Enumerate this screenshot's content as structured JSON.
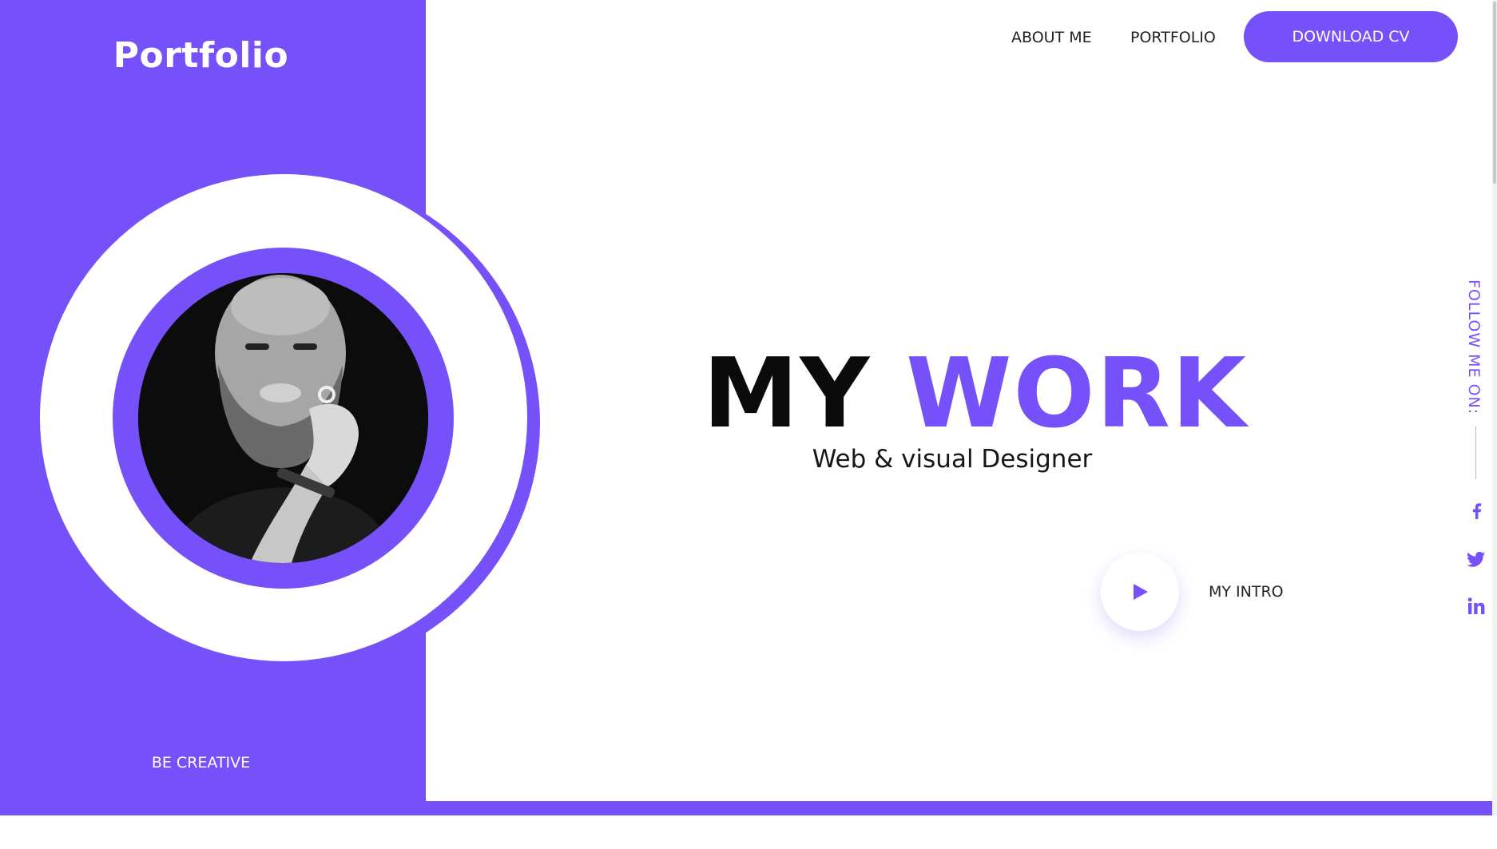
{
  "brand": {
    "title": "Portfolio",
    "motto": "BE CREATIVE"
  },
  "nav": {
    "links": [
      "ABOUT ME",
      "PORTFOLIO"
    ],
    "cta": "DOWNLOAD CV"
  },
  "hero": {
    "title_word1": "MY",
    "title_word2": "WORK",
    "subtitle": "Web & visual Designer",
    "intro_label": "MY INTRO"
  },
  "social": {
    "label": "FOLLOW ME ON:",
    "icons": [
      "facebook-icon",
      "twitter-icon",
      "linkedin-icon"
    ]
  },
  "theme": {
    "accent": "#7650f8",
    "text": "#222222",
    "background": "#ffffff"
  }
}
